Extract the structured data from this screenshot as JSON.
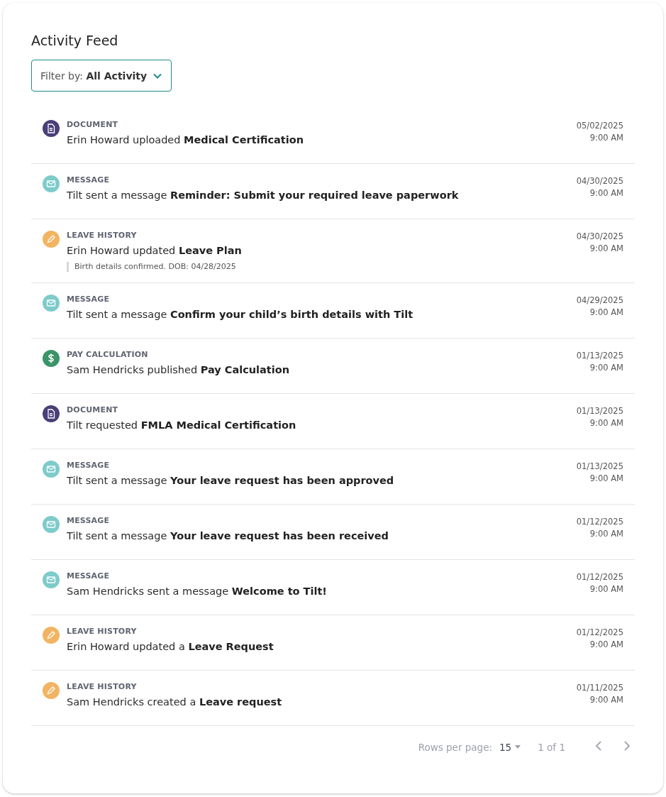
{
  "title": "Activity Feed",
  "filter": {
    "label": "Filter by:",
    "value": "All Activity"
  },
  "items": [
    {
      "kind": "document",
      "category": "DOCUMENT",
      "text": "Erin Howard uploaded **Medical Certification**",
      "date": "05/02/2025",
      "time": "9:00 AM"
    },
    {
      "kind": "message",
      "category": "MESSAGE",
      "text": "Tilt sent a message **Reminder: Submit your required leave paperwork**",
      "date": "04/30/2025",
      "time": "9:00 AM"
    },
    {
      "kind": "leave",
      "category": "LEAVE HISTORY",
      "text": "Erin Howard updated **Leave Plan**",
      "note": "Birth details confirmed. DOB: 04/28/2025",
      "date": "04/30/2025",
      "time": "9:00 AM"
    },
    {
      "kind": "message",
      "category": "MESSAGE",
      "text": "Tilt sent a message **Confirm your child’s birth details with Tilt**",
      "date": "04/29/2025",
      "time": "9:00 AM"
    },
    {
      "kind": "pay",
      "category": "PAY CALCULATION",
      "text": "Sam Hendricks published **Pay Calculation**",
      "date": "01/13/2025",
      "time": "9:00 AM"
    },
    {
      "kind": "document",
      "category": "DOCUMENT",
      "text": "Tilt requested **FMLA Medical Certification**",
      "date": "01/13/2025",
      "time": "9:00 AM"
    },
    {
      "kind": "message",
      "category": "MESSAGE",
      "text": "Tilt sent a message **Your leave request has been approved**",
      "date": "01/13/2025",
      "time": "9:00 AM"
    },
    {
      "kind": "message",
      "category": "MESSAGE",
      "text": "Tilt sent a message **Your leave request has been received**",
      "date": "01/12/2025",
      "time": "9:00 AM"
    },
    {
      "kind": "message",
      "category": "MESSAGE",
      "text": "Sam Hendricks sent a message **Welcome to Tilt!**",
      "date": "01/12/2025",
      "time": "9:00 AM"
    },
    {
      "kind": "leave",
      "category": "LEAVE HISTORY",
      "text": "Erin Howard updated a **Leave Request**",
      "date": "01/12/2025",
      "time": "9:00 AM"
    },
    {
      "kind": "leave",
      "category": "LEAVE HISTORY",
      "text": "Sam Hendricks created a **Leave request**",
      "date": "01/11/2025",
      "time": "9:00 AM"
    }
  ],
  "pagination": {
    "rows_label": "Rows per page:",
    "rows_value": "15",
    "range": "1 of 1",
    "prev_disabled": true,
    "next_disabled": true
  }
}
